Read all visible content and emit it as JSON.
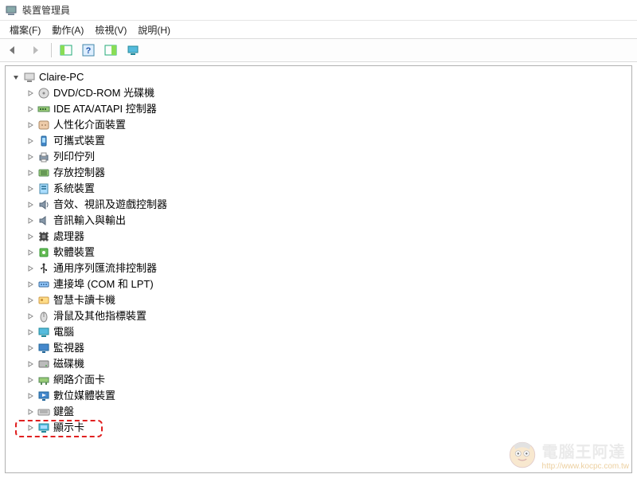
{
  "window": {
    "title": "裝置管理員"
  },
  "menu": {
    "file": "檔案(F)",
    "action": "動作(A)",
    "view": "檢視(V)",
    "help": "說明(H)"
  },
  "tree": {
    "root": "Claire-PC",
    "items": [
      {
        "label": "DVD/CD-ROM 光碟機",
        "icon": "disc"
      },
      {
        "label": "IDE ATA/ATAPI 控制器",
        "icon": "ide"
      },
      {
        "label": "人性化介面裝置",
        "icon": "hid"
      },
      {
        "label": "可攜式裝置",
        "icon": "portable"
      },
      {
        "label": "列印佇列",
        "icon": "printer"
      },
      {
        "label": "存放控制器",
        "icon": "storage"
      },
      {
        "label": "系統裝置",
        "icon": "system"
      },
      {
        "label": "音效、視訊及遊戲控制器",
        "icon": "sound"
      },
      {
        "label": "音訊輸入與輸出",
        "icon": "audio"
      },
      {
        "label": "處理器",
        "icon": "cpu"
      },
      {
        "label": "軟體裝置",
        "icon": "software"
      },
      {
        "label": "通用序列匯流排控制器",
        "icon": "usb"
      },
      {
        "label": "連接埠 (COM 和 LPT)",
        "icon": "port"
      },
      {
        "label": "智慧卡讀卡機",
        "icon": "smartcard"
      },
      {
        "label": "滑鼠及其他指標裝置",
        "icon": "mouse"
      },
      {
        "label": "電腦",
        "icon": "computer"
      },
      {
        "label": "監視器",
        "icon": "monitor"
      },
      {
        "label": "磁碟機",
        "icon": "disk"
      },
      {
        "label": "網路介面卡",
        "icon": "network"
      },
      {
        "label": "數位媒體裝置",
        "icon": "media"
      },
      {
        "label": "鍵盤",
        "icon": "keyboard"
      },
      {
        "label": "顯示卡",
        "icon": "display"
      }
    ]
  },
  "watermark": {
    "main": "電腦王阿達",
    "url": "http://www.kocpc.com.tw"
  }
}
